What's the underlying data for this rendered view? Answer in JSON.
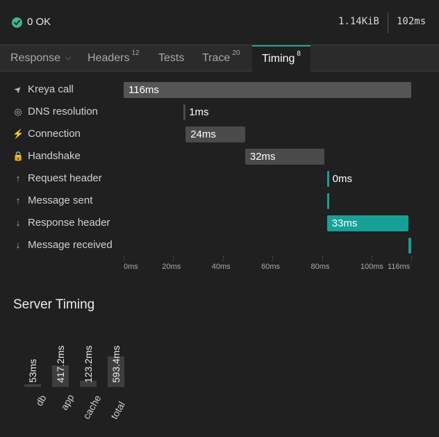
{
  "status": {
    "text": "0 OK",
    "size": "1.14KiB",
    "duration": "102ms",
    "ok_color": "#3fb68b"
  },
  "tabs": [
    {
      "label": "Response",
      "badge": ""
    },
    {
      "label": "Headers",
      "badge": "12"
    },
    {
      "label": "Tests",
      "badge": ""
    },
    {
      "label": "Trace",
      "badge": "20"
    },
    {
      "label": "Timing",
      "badge": "8"
    }
  ],
  "timing": {
    "rows": [
      {
        "label": "Kreya call",
        "icon": "send-icon",
        "bar_label": "116ms",
        "start": 0,
        "duration": 116
      },
      {
        "label": "DNS resolution",
        "icon": "globe-icon",
        "bar_label": "1ms",
        "start": 24,
        "duration": 1
      },
      {
        "label": "Connection",
        "icon": "plug-icon",
        "bar_label": "24ms",
        "start": 25,
        "duration": 24
      },
      {
        "label": "Handshake",
        "icon": "lock-icon",
        "bar_label": "32ms",
        "start": 49,
        "duration": 32
      },
      {
        "label": "Request header",
        "icon": "arrow-up-icon",
        "bar_label": "0ms",
        "start": 82,
        "duration": 0
      },
      {
        "label": "Message sent",
        "icon": "arrow-up-icon",
        "bar_label": "",
        "start": 82,
        "duration": 0
      },
      {
        "label": "Response header",
        "icon": "arrow-down-icon",
        "bar_label": "33ms",
        "start": 82,
        "duration": 33
      },
      {
        "label": "Message received",
        "icon": "arrow-down-icon",
        "bar_label": "",
        "start": 115,
        "duration": 1
      }
    ],
    "ticks": [
      "0ms",
      "20ms",
      "40ms",
      "60ms",
      "80ms",
      "100ms",
      "116ms"
    ],
    "tick_values": [
      0,
      20,
      40,
      60,
      80,
      100,
      116
    ],
    "max": 116,
    "colors": {
      "gray": "#4b4b4b",
      "teal": "#16a097"
    }
  },
  "server_timing": {
    "title": "Server Timing",
    "chart_data": {
      "type": "bar",
      "categories": [
        "db",
        "app",
        "cache",
        "total"
      ],
      "values": [
        53,
        417.2,
        123.2,
        593.4
      ],
      "value_labels": [
        "53ms",
        "417.2ms",
        "123.2ms",
        "593.4ms"
      ]
    }
  }
}
